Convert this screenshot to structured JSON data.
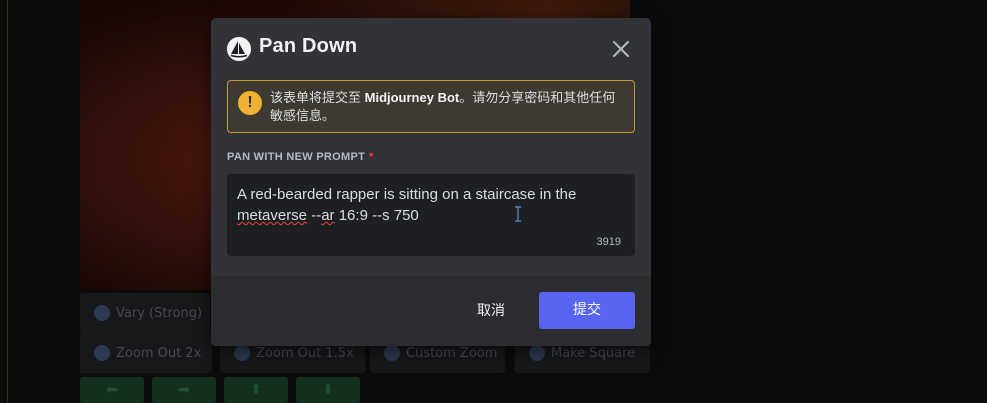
{
  "modal": {
    "title": "Pan Down",
    "warning_text": "该表单将提交至 ",
    "warning_bot": "Midjourney Bot",
    "warning_rest": "。请勿分享密码和其他任何敏感信息。",
    "field_label": "PAN WITH NEW PROMPT",
    "required_mark": "*",
    "prompt_part1": "A red-bearded rapper is sitting on a staircase in the ",
    "prompt_misspelled": "metaverse",
    "prompt_part2": " --",
    "prompt_misspelled2": "ar",
    "prompt_part3": " 16:9 --s 750",
    "char_count": "3919",
    "cancel_label": "取消",
    "submit_label": "提交"
  },
  "background": {
    "buttons": [
      {
        "label": "Vary (Strong)"
      },
      {
        "label": "Zoom Out 2x"
      },
      {
        "label": "Zoom Out 1.5x"
      },
      {
        "label": "Custom Zoom"
      },
      {
        "label": "Make Square"
      }
    ],
    "arrows": [
      "⬅",
      "➡",
      "⬆",
      "⬇"
    ]
  },
  "colors": {
    "modal_bg": "#313338",
    "footer_bg": "#2b2d31",
    "accent": "#5865f2",
    "warning": "#f0b232",
    "required": "#f23f43"
  },
  "icons": [
    "midjourney-bot-avatar-icon",
    "close-icon",
    "warning-icon",
    "text-cursor-icon"
  ]
}
